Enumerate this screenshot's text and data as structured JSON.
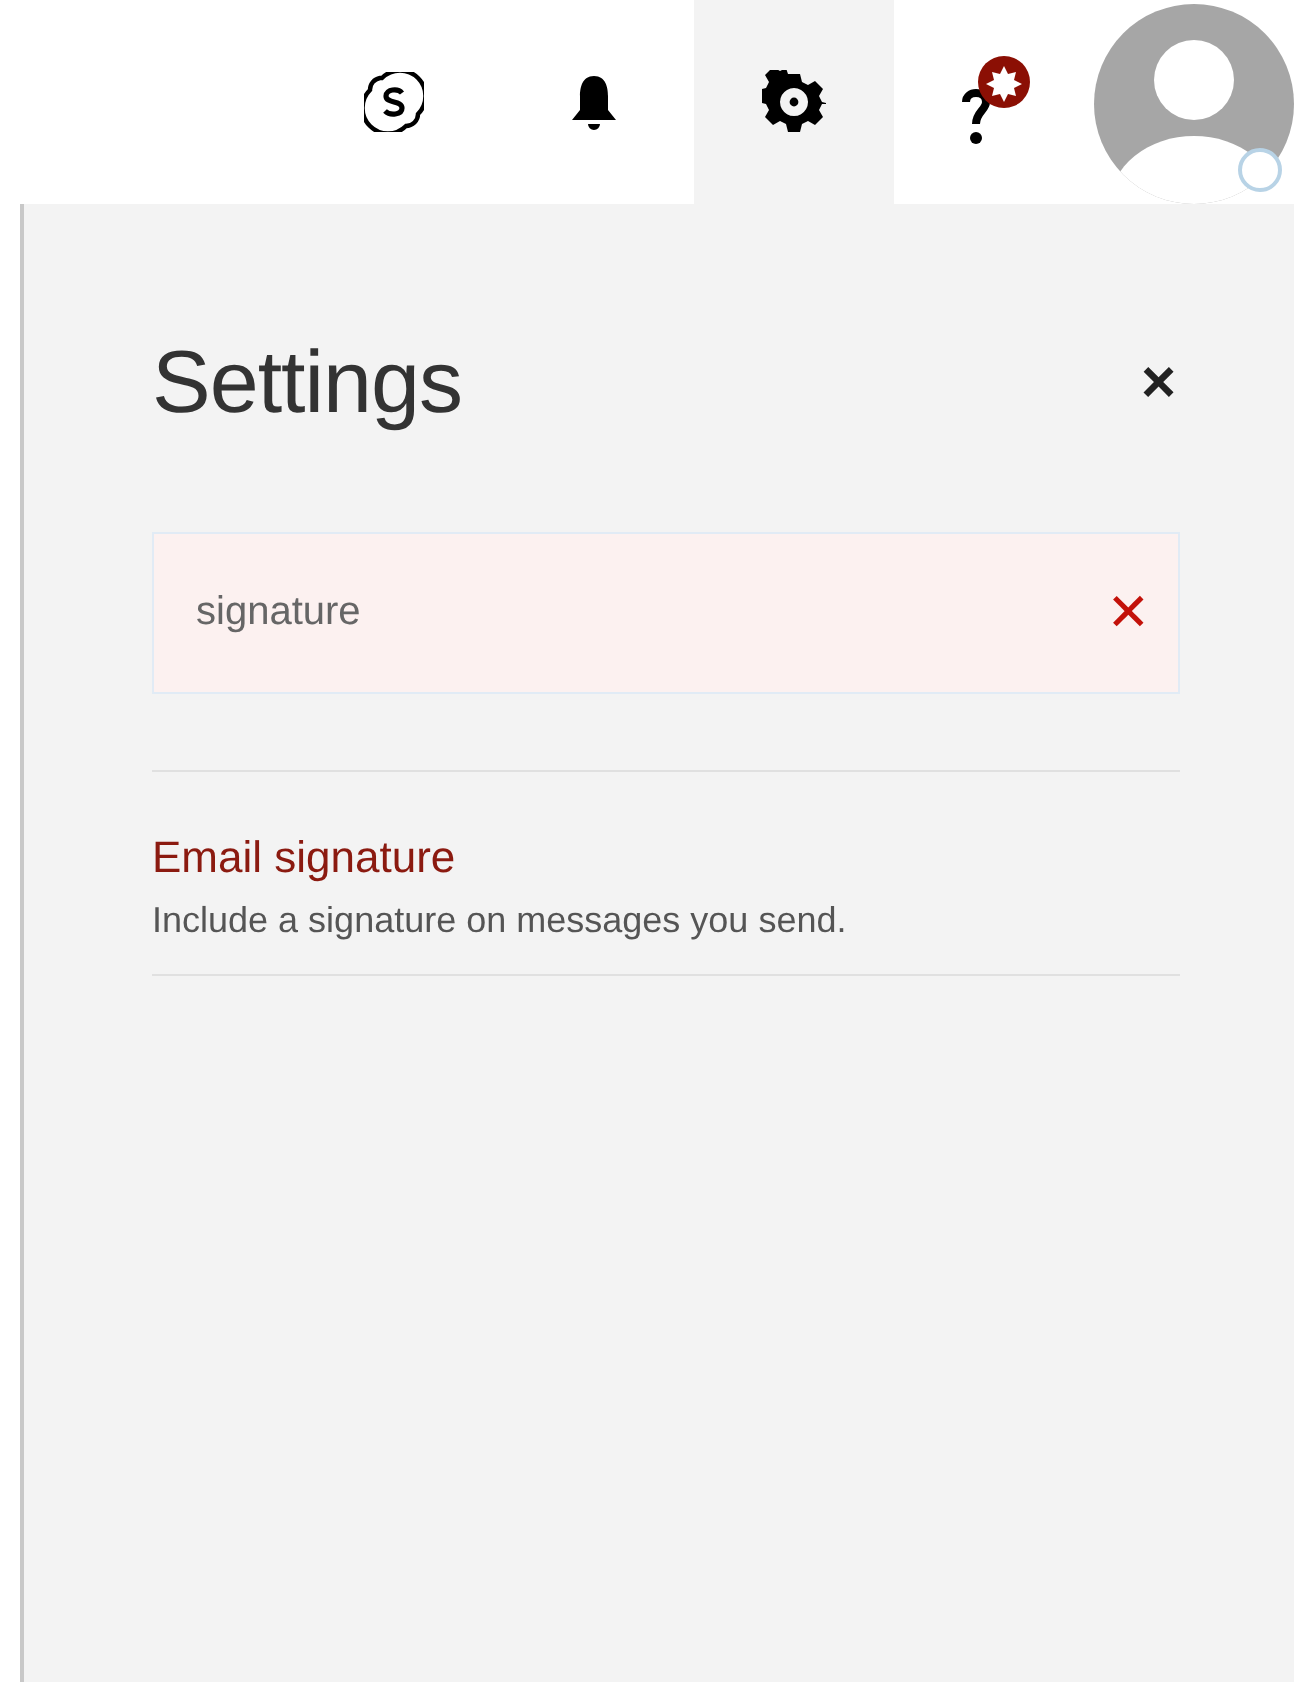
{
  "toolbar": [
    {
      "kind": "skype",
      "selected": false
    },
    {
      "kind": "bell",
      "selected": false
    },
    {
      "kind": "gear",
      "selected": true
    },
    {
      "kind": "help",
      "selected": false
    },
    {
      "kind": "avatar",
      "selected": false
    }
  ],
  "settings": {
    "title": "Settings",
    "close": "×",
    "search": {
      "value": "signature",
      "clear": "✕"
    },
    "results": [
      {
        "title": "Email signature",
        "description": "Include a signature on messages you send."
      }
    ]
  }
}
